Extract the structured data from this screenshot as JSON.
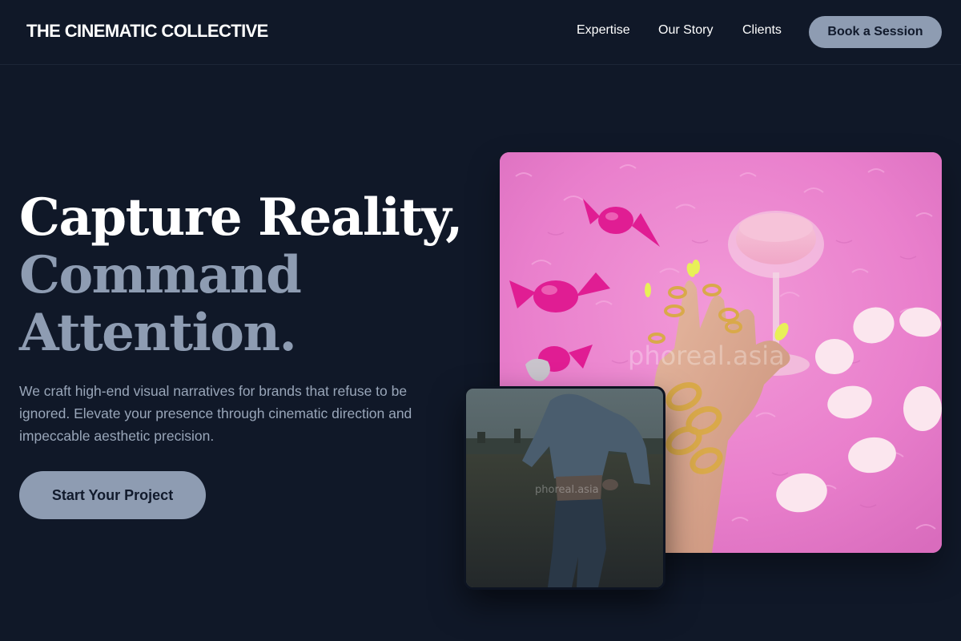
{
  "header": {
    "brand": "THE CINEMATIC COLLECTIVE",
    "nav": [
      "Expertise",
      "Our Story",
      "Clients"
    ],
    "cta_label": "Book a Session"
  },
  "hero": {
    "headline_line1": "Capture Reality,",
    "headline_line2": "Command",
    "headline_line3": "Attention.",
    "subtext": "We craft high-end visual narratives for brands that refuse to be ignored. Elevate your presence through cinematic direction and impeccable aesthetic precision.",
    "cta_label": "Start Your Project"
  },
  "images": {
    "main_watermark": "phoreal.asia",
    "secondary_watermark": "phoreal.asia"
  },
  "colors": {
    "background": "#101828",
    "accent": "#8e9cb2",
    "text_primary": "#ffffff",
    "text_muted": "#99a6b9"
  }
}
